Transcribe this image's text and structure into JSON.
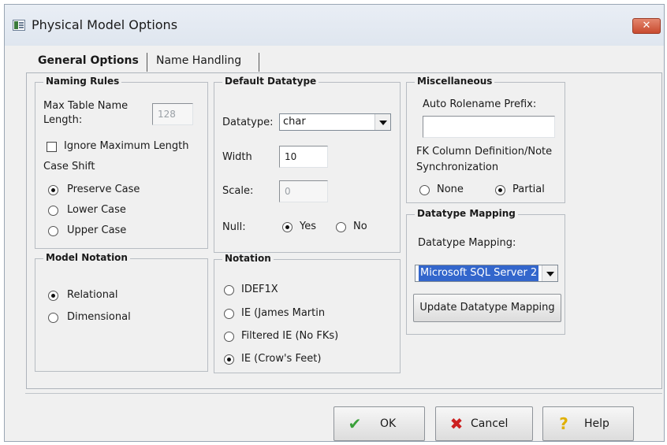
{
  "window": {
    "title": "Physical Model Options",
    "close_label": "✕"
  },
  "tabs": [
    {
      "label": "General Options",
      "active": true
    },
    {
      "label": "Name Handling",
      "active": false
    }
  ],
  "naming_rules": {
    "legend": "Naming Rules",
    "max_label_1": "Max Table Name",
    "max_label_2": "Length:",
    "max_value": "128",
    "ignore_label": "Ignore Maximum Length",
    "ignore_checked": false,
    "case_shift_label": "Case Shift",
    "options": [
      "Preserve Case",
      "Lower Case",
      "Upper Case"
    ],
    "selected": "Preserve Case"
  },
  "default_datatype": {
    "legend": "Default Datatype",
    "datatype_label": "Datatype:",
    "datatype_value": "char",
    "width_label": "Width",
    "width_value": "10",
    "scale_label": "Scale:",
    "scale_value": "0",
    "null_label": "Null:",
    "null_yes": "Yes",
    "null_no": "No",
    "null_selected": "Yes"
  },
  "miscellaneous": {
    "legend": "Miscellaneous",
    "prefix_label": "Auto Rolename Prefix:",
    "prefix_value": "",
    "fk_label_1": "FK Column Definition/Note",
    "fk_label_2": "Synchronization",
    "fk_none": "None",
    "fk_partial": "Partial",
    "fk_selected": "Partial"
  },
  "datatype_mapping": {
    "legend": "Datatype Mapping",
    "label": "Datatype Mapping:",
    "value": "Microsoft SQL Server 2",
    "update_button": "Update Datatype Mapping"
  },
  "model_notation": {
    "legend": "Model Notation",
    "options": [
      "Relational",
      "Dimensional"
    ],
    "selected": "Relational"
  },
  "notation": {
    "legend": "Notation",
    "options": [
      "IDEF1X",
      "IE (James Martin",
      "Filtered IE (No FKs)",
      "IE (Crow's Feet)"
    ],
    "selected": "IE (Crow's Feet)"
  },
  "buttons": {
    "ok": "OK",
    "cancel": "Cancel",
    "help": "Help"
  },
  "colors": {
    "ok_icon": "#3aa03a",
    "cancel_icon": "#cc1f1f",
    "help_icon": "#e0b000",
    "selection": "#3366cc"
  }
}
